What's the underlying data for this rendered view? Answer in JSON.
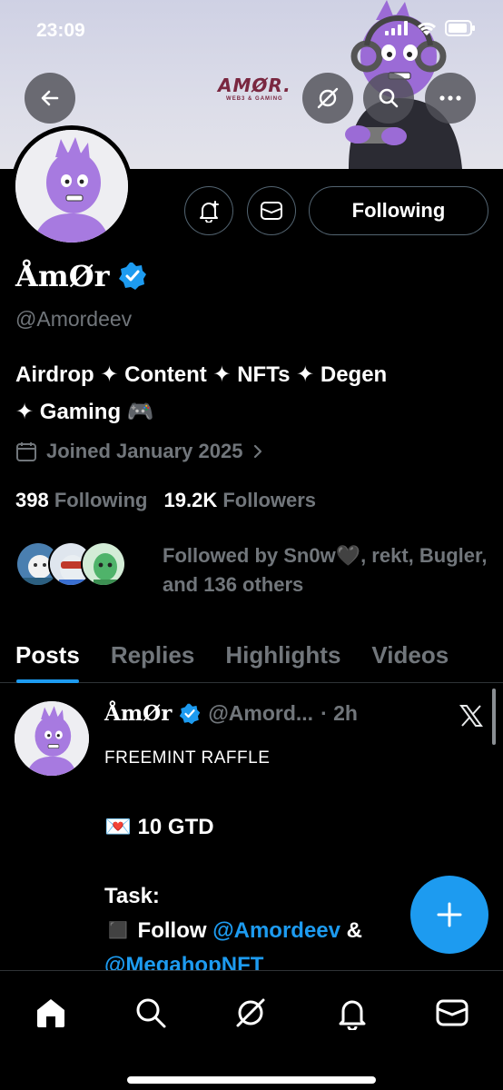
{
  "status_bar": {
    "time": "23:09"
  },
  "banner": {
    "logo_text": "AMØR.",
    "logo_sub": "WEB3 & GAMING"
  },
  "profile": {
    "display_name": "ÅmØr",
    "handle": "@Amordeev",
    "following_button": "Following",
    "bio_line1": "Airdrop ✦ Content ✦ NFTs ✦ Degen",
    "bio_line2": "✦ Gaming 🎮",
    "joined": "Joined January 2025",
    "following_count": "398",
    "following_label": "Following",
    "followers_count": "19.2K",
    "followers_label": "Followers",
    "followed_by": "Followed by Sn0w🖤, rekt, Bugler, and 136 others"
  },
  "tabs": [
    "Posts",
    "Replies",
    "Highlights",
    "Videos"
  ],
  "post": {
    "name": "ÅmØr",
    "handle": "@Amord...",
    "time": "· 2h",
    "line1": "FREEMINT RAFFLE",
    "line2": "💌 10 GTD",
    "line3": "Task:",
    "line4_prefix": "◼️ Follow",
    "mention1": "@Amordeev",
    "amp": "&",
    "mention2": "@MegahopNFT"
  },
  "colors": {
    "accent": "#1d9bf0",
    "muted": "#71767b",
    "border": "#2f3336"
  }
}
